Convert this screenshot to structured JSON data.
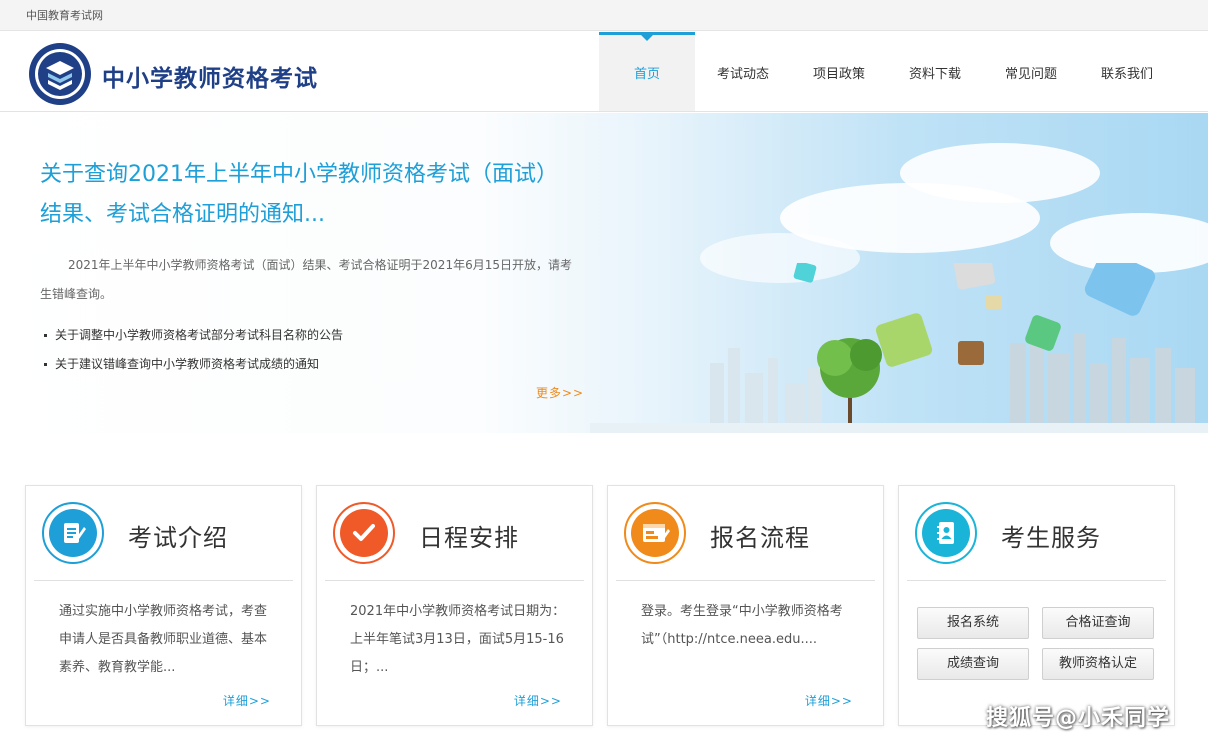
{
  "top_strip": {
    "site_name": "中国教育考试网"
  },
  "header": {
    "title": "中小学教师资格考试",
    "nav": [
      {
        "label": "首页",
        "active": true
      },
      {
        "label": "考试动态"
      },
      {
        "label": "项目政策"
      },
      {
        "label": "资料下载"
      },
      {
        "label": "常见问题"
      },
      {
        "label": "联系我们"
      }
    ]
  },
  "banner": {
    "headline": "关于查询2021年上半年中小学教师资格考试（面试）结果、考试合格证明的通知...",
    "description": "2021年上半年中小学教师资格考试（面试）结果、考试合格证明于2021年6月15日开放，请考生错峰查询。",
    "links": [
      "关于调整中小学教师资格考试部分考试科目名称的公告",
      "关于建议错峰查询中小学教师资格考试成绩的通知"
    ],
    "more": "更多>>"
  },
  "cards": [
    {
      "title": "考试介绍",
      "text": "通过实施中小学教师资格考试，考查申请人是否具备教师职业道德、基本素养、教育教学能...",
      "detail": "详细>>",
      "icon": "document-edit-icon",
      "color": "#1e9fd7"
    },
    {
      "title": "日程安排",
      "text": "2021年中小学教师资格考试日期为：上半年笔试3月13日，面试5月15-16日；...",
      "detail": "详细>>",
      "icon": "checkmark-icon",
      "color": "#f05a28"
    },
    {
      "title": "报名流程",
      "text": "登录。考生登录“中小学教师资格考试”（http://ntce.neea.edu....",
      "detail": "详细>>",
      "icon": "registration-form-icon",
      "color": "#f08a1a"
    },
    {
      "title": "考生服务",
      "icon": "contact-book-icon",
      "color": "#1ab4d8"
    }
  ],
  "services": [
    "报名系统",
    "合格证查询",
    "成绩查询",
    "教师资格认定"
  ],
  "watermark": "搜狐号@小禾同学"
}
